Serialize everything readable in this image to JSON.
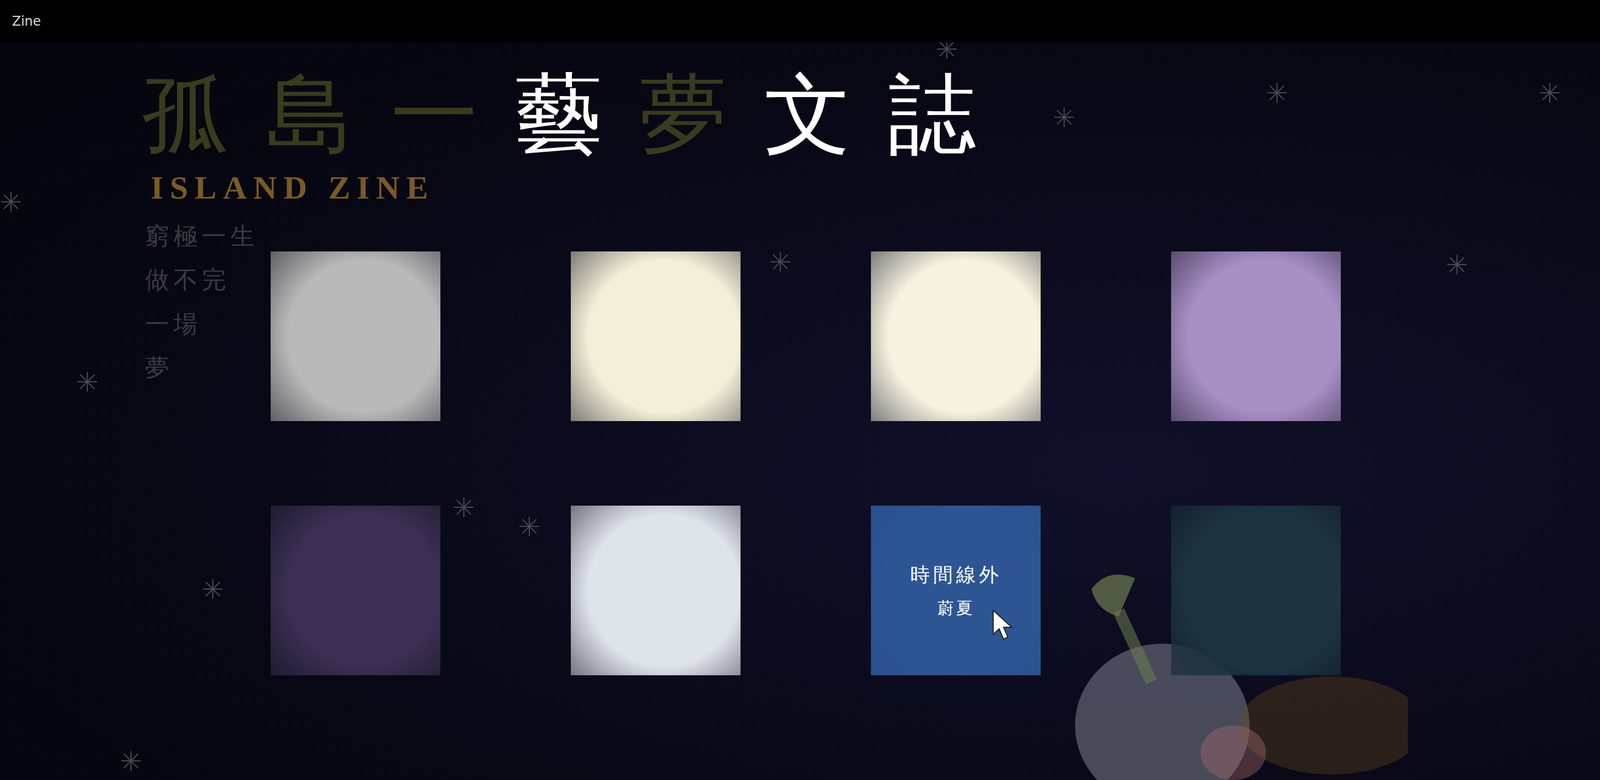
{
  "window": {
    "title": "Zine"
  },
  "title": [
    {
      "text": "孤",
      "faded": true
    },
    {
      "text": "島",
      "faded": true
    },
    {
      "text": "一",
      "faded": true
    },
    {
      "text": "藝",
      "faded": false
    },
    {
      "text": "夢",
      "faded": true
    },
    {
      "text": "文",
      "faded": false
    },
    {
      "text": "誌",
      "faded": false
    }
  ],
  "subtitle": "ISLAND ZINE",
  "tagline": [
    "窮極一生",
    "做不完",
    "一場",
    "夢"
  ],
  "tiles": [
    {
      "color": "#b9b9b9",
      "hovered": false
    },
    {
      "color": "#f4efd9",
      "hovered": false
    },
    {
      "color": "#f6f2e0",
      "hovered": false
    },
    {
      "color": "#a88fc4",
      "hovered": false
    },
    {
      "color": "#3b2f52",
      "hovered": false
    },
    {
      "color": "#dfe3ea",
      "hovered": false
    },
    {
      "color": "#2b4e85",
      "hovered": true,
      "title": "時間線外",
      "author": "蔚夏"
    },
    {
      "color": "#1d3440",
      "hovered": false
    }
  ]
}
